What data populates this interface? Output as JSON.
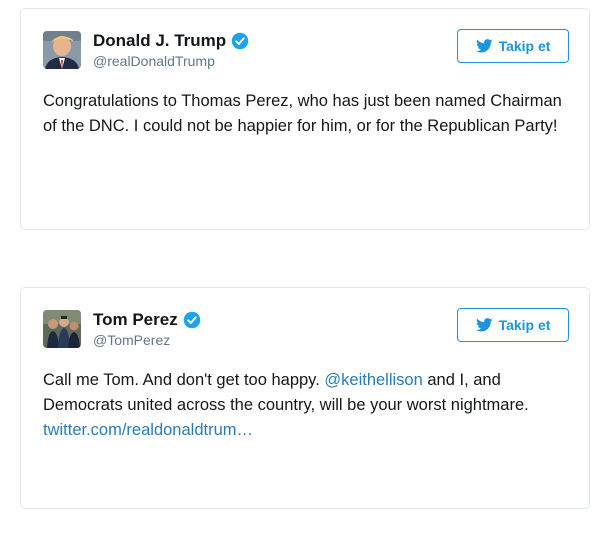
{
  "colors": {
    "link": "#2b7bb9",
    "follow_accent": "#1b95e0",
    "verified": "#1da1f2",
    "border": "#e1e8ed",
    "handle": "#657786"
  },
  "tweets": [
    {
      "author": {
        "name": "Donald J. Trump",
        "handle": "@realDonaldTrump",
        "verified": true,
        "avatar_icon": "avatar-photo"
      },
      "follow_button": {
        "label": "Takip et",
        "icon": "twitter-bird-icon"
      },
      "text": {
        "parts": [
          "Congratulations to Thomas Perez, who has just been named Chairman of the DNC. I could not be happier for him, or for the Republican Party!"
        ]
      }
    },
    {
      "author": {
        "name": "Tom Perez",
        "handle": "@TomPerez",
        "verified": true,
        "avatar_icon": "avatar-photo"
      },
      "follow_button": {
        "label": "Takip et",
        "icon": "twitter-bird-icon"
      },
      "text": {
        "before_mention": "Call me Tom. And don't get too happy. ",
        "mention": "@keithellison",
        "after_mention": " and I, and Democrats united across the country, will be your worst nightmare. ",
        "link": "twitter.com/realdonaldtrum…"
      }
    }
  ]
}
